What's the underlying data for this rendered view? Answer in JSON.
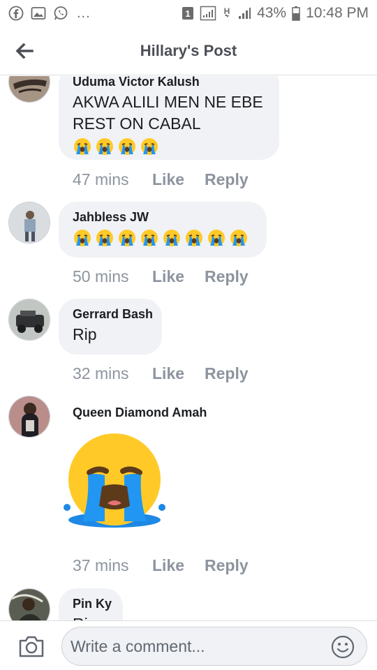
{
  "status_bar": {
    "battery": "43%",
    "time": "10:48 PM",
    "dots": "...",
    "sim": "1",
    "network": "H"
  },
  "header": {
    "title": "Hillary's Post"
  },
  "comments": [
    {
      "author": "Uduma Victor Kalush",
      "text": "AKWA ALILI MEN NE EBE REST ON CABAL",
      "emoji_count": 4,
      "time": "47 mins",
      "like": "Like",
      "reply": "Reply"
    },
    {
      "author": "Jahbless JW",
      "text": "",
      "emoji_count": 8,
      "time": "50 mins",
      "like": "Like",
      "reply": "Reply"
    },
    {
      "author": "Gerrard Bash",
      "text": "Rip",
      "emoji_count": 0,
      "time": "32 mins",
      "like": "Like",
      "reply": "Reply"
    },
    {
      "author": "Queen Diamond Amah",
      "text": "",
      "sticker": "loudly-crying-face",
      "time": "37 mins",
      "like": "Like",
      "reply": "Reply"
    },
    {
      "author": "Pin Ky",
      "text": "Ri"
    }
  ],
  "composer": {
    "placeholder": "Write a comment..."
  },
  "colors": {
    "bubble": "#f0f2f5",
    "meta": "#8d949e",
    "title": "#4b4f56",
    "emoji_yellow": "#ffca28",
    "emoji_tear": "#2196f3"
  }
}
